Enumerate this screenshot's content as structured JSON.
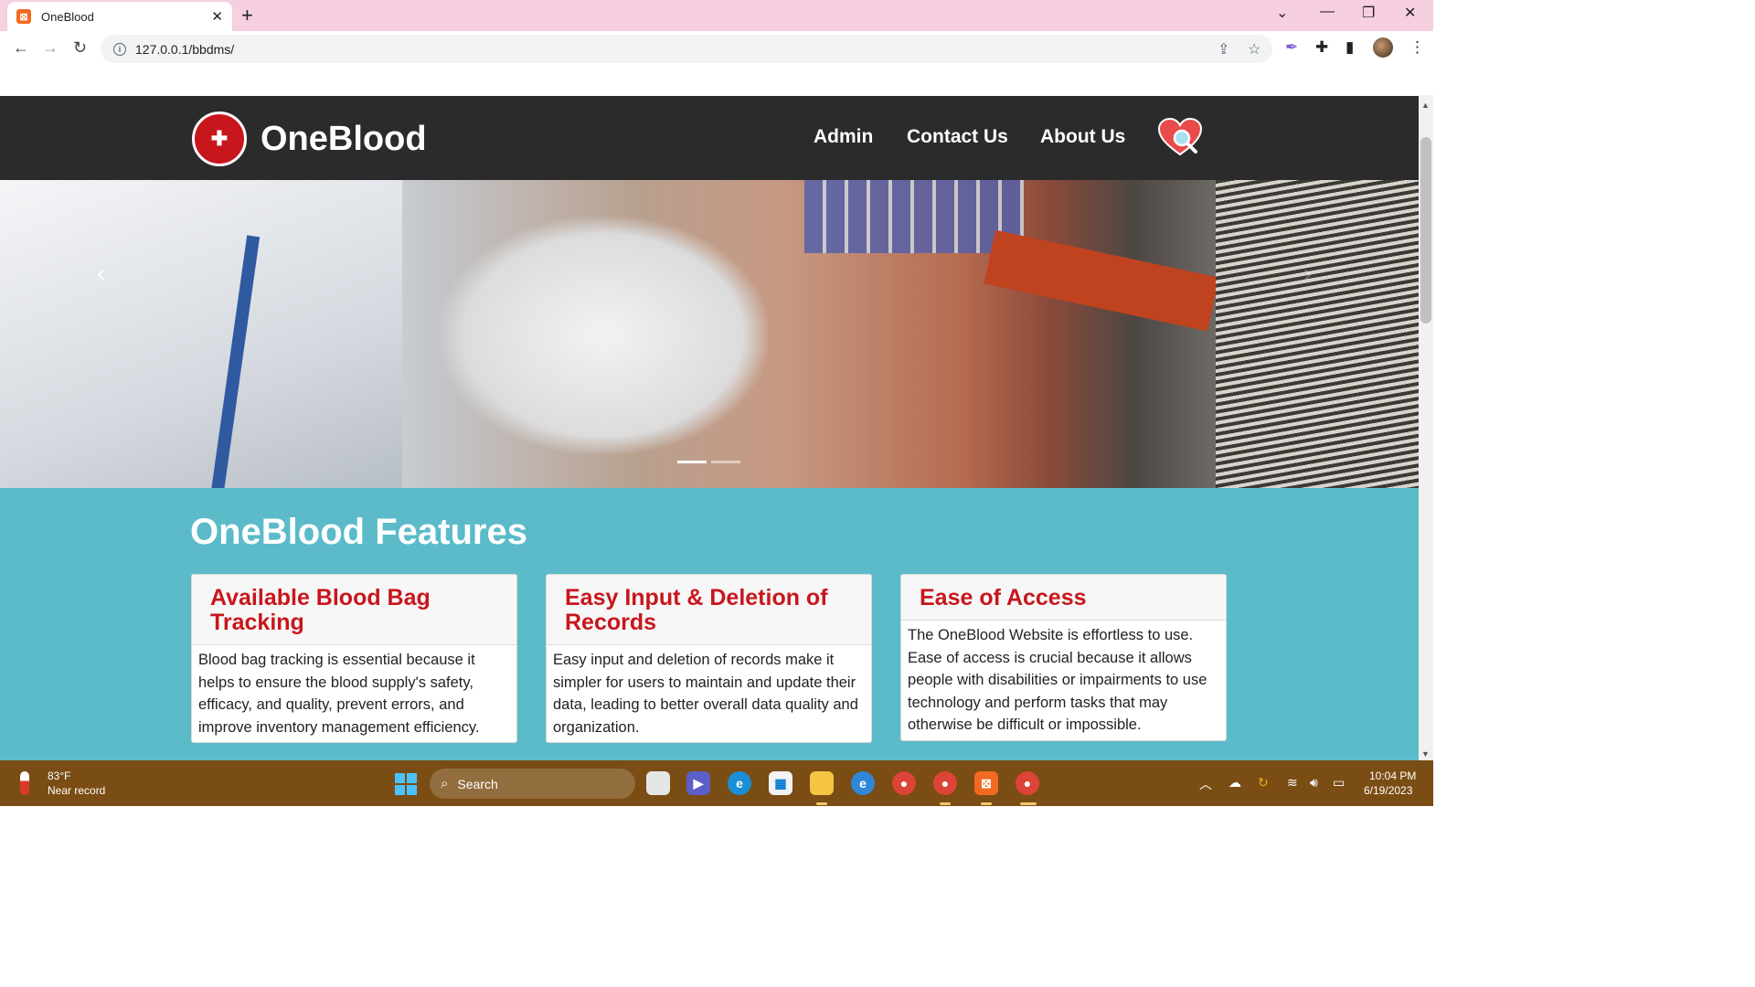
{
  "browser": {
    "tab_title": "OneBlood",
    "tab_favicon_letter": "⊞",
    "url": "127.0.0.1/bbdms/"
  },
  "site": {
    "brand": "OneBlood",
    "nav": {
      "admin": "Admin",
      "contact": "Contact Us",
      "about": "About Us"
    },
    "carousel": {
      "slide_count": 2,
      "active_index": 0
    },
    "features": {
      "title": "OneBlood Features",
      "cards": [
        {
          "title": "Available Blood Bag Tracking",
          "body": "Blood bag tracking is essential because it helps to ensure the blood supply's safety, efficacy, and quality, prevent errors, and improve inventory management efficiency."
        },
        {
          "title": "Easy Input & Deletion of Records",
          "body": "Easy input and deletion of records make it simpler for users to maintain and update their data, leading to better overall data quality and organization."
        },
        {
          "title": "Ease of Access",
          "body": "The OneBlood Website is effortless to use. Ease of access is crucial because it allows people with disabilities or impairments to use technology and perform tasks that may otherwise be difficult or impossible."
        }
      ]
    },
    "colors": {
      "nav_bg": "#2b2b2b",
      "accent_red": "#c8161d",
      "features_bg": "#5bbbc9"
    }
  },
  "taskbar": {
    "weather_temp": "83°F",
    "weather_desc": "Near record",
    "search_label": "Search",
    "time": "10:04 PM",
    "date": "6/19/2023"
  }
}
